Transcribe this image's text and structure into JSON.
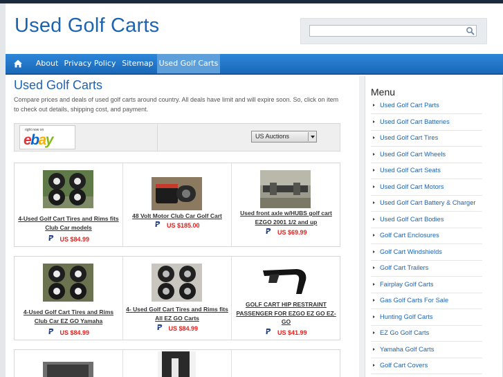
{
  "header": {
    "site_title": "Used Golf Carts",
    "search_value": "",
    "search_icon": "magnifier-icon"
  },
  "nav": {
    "home_icon": "home-icon",
    "items": [
      {
        "label": "About"
      },
      {
        "label": "Privacy Policy"
      },
      {
        "label": "Sitemap"
      },
      {
        "label": "Used Golf Carts",
        "active": true
      }
    ]
  },
  "main": {
    "title": "Used Golf Carts",
    "description": "Compare prices and deals of used golf carts around country. All deals have limit and will expire soon. So, click on item to check out details, shipping cost, and payment.",
    "ebay_tagline": "right now on",
    "ebay_logo": "ebay",
    "auction_select": "US Auctions"
  },
  "products": [
    {
      "title": "4-Used Golf Cart Tires and Rims fits Club Car models",
      "price": "US $84.99",
      "image": "four-tires"
    },
    {
      "title": "48 Volt Motor Club Car Golf Cart",
      "price": "US $185.00",
      "image": "motor"
    },
    {
      "title": "Used front axle w/HUBS golf cart EZGO 2001 1/2 and up",
      "price": "US $69.99",
      "image": "axle"
    },
    {
      "title": "4-Used Golf Cart Tires and Rims Club Car EZ GO Yamaha",
      "price": "US $84.99",
      "image": "four-tires"
    },
    {
      "title": "4- Used Golf Cart Tires and Rims fits All EZ GO Carts",
      "price": "US $84.99",
      "image": "four-tires"
    },
    {
      "title": "GOLF CART HIP RESTRAINT PASSENGER FOR EZGO EZ GO EZ-GO",
      "price": "US $41.99",
      "image": "hip-restraint"
    }
  ],
  "sidebar": {
    "title": "Menu",
    "items": [
      "Used Golf Cart Parts",
      "Used Golf Cart Batteries",
      "Used Golf Cart Tires",
      "Used Golf Cart Wheels",
      "Used Golf Cart Seats",
      "Used Golf Cart Motors",
      "Used Golf Cart Battery & Charger",
      "Used Golf Cart Bodies",
      "Golf Cart Enclosures",
      "Golf Cart Windshields",
      "Golf Cart Trailers",
      "Fairplay Golf Carts",
      "Gas Golf Carts For Sale",
      "Hunting Golf Carts",
      "EZ Go Golf Carts",
      "Yamaha Golf Carts",
      "Golf Cart Covers"
    ]
  },
  "colors": {
    "accent": "#1d63b0",
    "nav": "#2276c8",
    "price": "#e2211c"
  }
}
